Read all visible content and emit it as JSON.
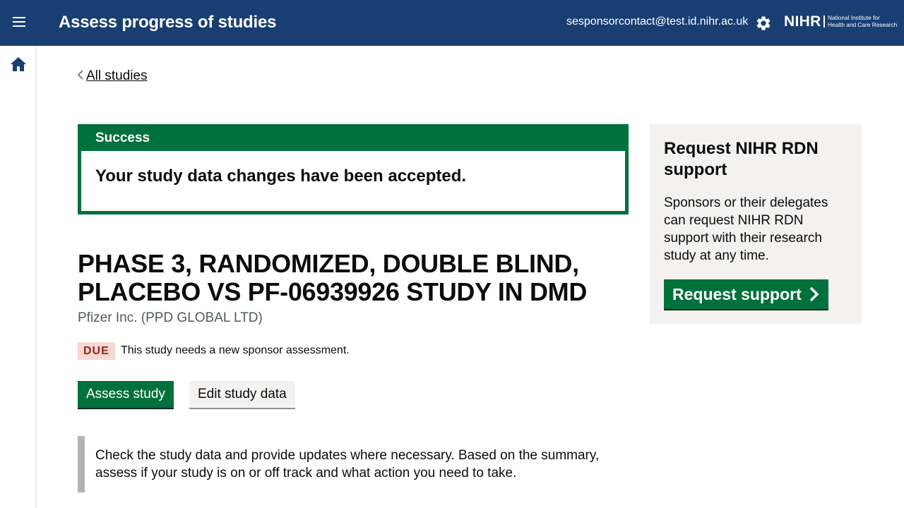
{
  "header": {
    "title": "Assess progress of studies",
    "user_email": "sesponsorcontact@test.id.nihr.ac.uk",
    "logo_main": "NIHR",
    "logo_line1": "National Institute for",
    "logo_line2": "Health and Care Research",
    "icons": [
      "menu-icon",
      "gear-icon"
    ]
  },
  "sidebar": {
    "icons": [
      "home-icon"
    ]
  },
  "breadcrumb": {
    "back_label": "All studies"
  },
  "success": {
    "title": "Success",
    "message": "Your study data changes have been accepted."
  },
  "panel": {
    "title": "Request NIHR RDN support",
    "text": "Sponsors or their delegates can request NIHR RDN support with their research study at any time.",
    "button_label": "Request support"
  },
  "study": {
    "title": "PHASE 3, RANDOMIZED, DOUBLE BLIND, PLACEBO VS PF-06939926 STUDY IN DMD",
    "sponsor": "Pfizer Inc. (PPD GLOBAL LTD)",
    "status_badge": "DUE",
    "status_text": "This study needs a new sponsor assessment.",
    "assess_label": "Assess study",
    "edit_label": "Edit study data",
    "inset_text": "Check the study data and provide updates where necessary. Based on the summary, assess if your study is on or off track and what action you need to take."
  },
  "colors": {
    "header_bg": "#193e72",
    "success_green": "#00703c",
    "due_bg": "#f6d7d2",
    "due_text": "#942514",
    "panel_bg": "#f3f2f1"
  }
}
